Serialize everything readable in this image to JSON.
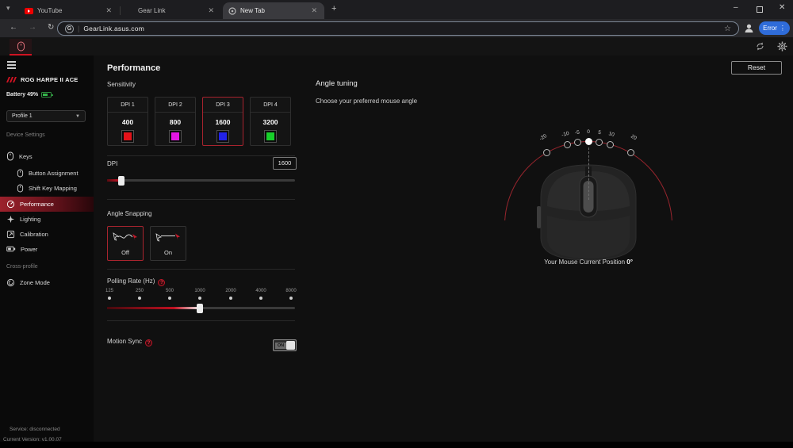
{
  "browser": {
    "tabs": [
      {
        "label": "YouTube"
      },
      {
        "label": "Gear Link"
      },
      {
        "label": "New Tab"
      }
    ],
    "url": "GearLink.asus.com",
    "error_button": "Error"
  },
  "app_chrome": {
    "reset": "Reset"
  },
  "sidebar": {
    "device_name": "ROG HARPE II ACE",
    "battery": "Battery 49%",
    "profile": "Profile 1",
    "section_device": "Device Settings",
    "section_cross": "Cross-profile",
    "items": [
      {
        "label": "Keys"
      },
      {
        "label": "Button Assignment"
      },
      {
        "label": "Shift Key Mapping"
      },
      {
        "label": "Performance",
        "active": true
      },
      {
        "label": "Lighting"
      },
      {
        "label": "Calibration"
      },
      {
        "label": "Power"
      },
      {
        "label": "Zone Mode"
      }
    ],
    "service": "Service: disconnected",
    "version": "Current Version: v1.00.07"
  },
  "performance": {
    "title": "Performance",
    "sensitivity": "Sensitivity",
    "dpi_presets": [
      {
        "label": "DPI 1",
        "value": "400",
        "color": "#e31219",
        "selected": false
      },
      {
        "label": "DPI 2",
        "value": "800",
        "color": "#e316e3",
        "selected": false
      },
      {
        "label": "DPI 3",
        "value": "1600",
        "color": "#2222e6",
        "selected": true
      },
      {
        "label": "DPI 4",
        "value": "3200",
        "color": "#17cf2a",
        "selected": false
      }
    ],
    "dpi_label": "DPI",
    "dpi_value": "1600",
    "angle_snapping": "Angle Snapping",
    "snap_off": "Off",
    "snap_on": "On",
    "polling_label": "Polling Rate (Hz)",
    "polling_rates": [
      "125",
      "250",
      "500",
      "1000",
      "2000",
      "4000",
      "8000"
    ],
    "polling_selected": "1000",
    "motion_sync": "Motion Sync",
    "motion_sync_state": "ON"
  },
  "angle": {
    "title": "Angle tuning",
    "subtitle": "Choose your preferred mouse angle",
    "scale": [
      "-20",
      "-10",
      "-5",
      "0",
      "5",
      "10",
      "20"
    ],
    "current": "0",
    "position_prefix": "Your Mouse Current Position",
    "position_value": "0°"
  }
}
